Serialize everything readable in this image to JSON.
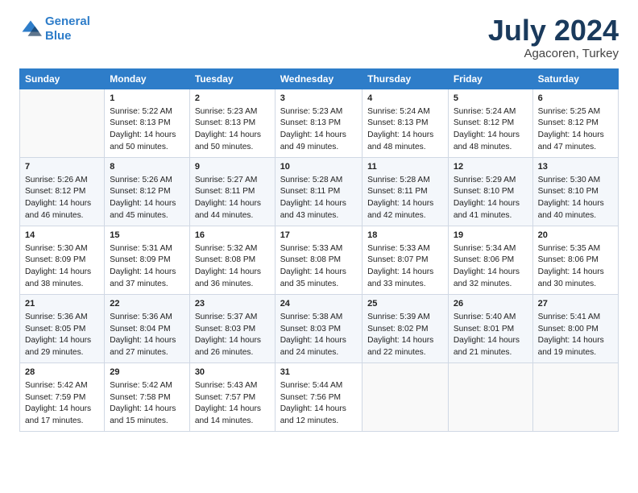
{
  "logo": {
    "line1": "General",
    "line2": "Blue"
  },
  "title": "July 2024",
  "subtitle": "Agacoren, Turkey",
  "header_days": [
    "Sunday",
    "Monday",
    "Tuesday",
    "Wednesday",
    "Thursday",
    "Friday",
    "Saturday"
  ],
  "weeks": [
    [
      {
        "day": "",
        "content": ""
      },
      {
        "day": "1",
        "content": "Sunrise: 5:22 AM\nSunset: 8:13 PM\nDaylight: 14 hours\nand 50 minutes."
      },
      {
        "day": "2",
        "content": "Sunrise: 5:23 AM\nSunset: 8:13 PM\nDaylight: 14 hours\nand 50 minutes."
      },
      {
        "day": "3",
        "content": "Sunrise: 5:23 AM\nSunset: 8:13 PM\nDaylight: 14 hours\nand 49 minutes."
      },
      {
        "day": "4",
        "content": "Sunrise: 5:24 AM\nSunset: 8:13 PM\nDaylight: 14 hours\nand 48 minutes."
      },
      {
        "day": "5",
        "content": "Sunrise: 5:24 AM\nSunset: 8:12 PM\nDaylight: 14 hours\nand 48 minutes."
      },
      {
        "day": "6",
        "content": "Sunrise: 5:25 AM\nSunset: 8:12 PM\nDaylight: 14 hours\nand 47 minutes."
      }
    ],
    [
      {
        "day": "7",
        "content": "Sunrise: 5:26 AM\nSunset: 8:12 PM\nDaylight: 14 hours\nand 46 minutes."
      },
      {
        "day": "8",
        "content": "Sunrise: 5:26 AM\nSunset: 8:12 PM\nDaylight: 14 hours\nand 45 minutes."
      },
      {
        "day": "9",
        "content": "Sunrise: 5:27 AM\nSunset: 8:11 PM\nDaylight: 14 hours\nand 44 minutes."
      },
      {
        "day": "10",
        "content": "Sunrise: 5:28 AM\nSunset: 8:11 PM\nDaylight: 14 hours\nand 43 minutes."
      },
      {
        "day": "11",
        "content": "Sunrise: 5:28 AM\nSunset: 8:11 PM\nDaylight: 14 hours\nand 42 minutes."
      },
      {
        "day": "12",
        "content": "Sunrise: 5:29 AM\nSunset: 8:10 PM\nDaylight: 14 hours\nand 41 minutes."
      },
      {
        "day": "13",
        "content": "Sunrise: 5:30 AM\nSunset: 8:10 PM\nDaylight: 14 hours\nand 40 minutes."
      }
    ],
    [
      {
        "day": "14",
        "content": "Sunrise: 5:30 AM\nSunset: 8:09 PM\nDaylight: 14 hours\nand 38 minutes."
      },
      {
        "day": "15",
        "content": "Sunrise: 5:31 AM\nSunset: 8:09 PM\nDaylight: 14 hours\nand 37 minutes."
      },
      {
        "day": "16",
        "content": "Sunrise: 5:32 AM\nSunset: 8:08 PM\nDaylight: 14 hours\nand 36 minutes."
      },
      {
        "day": "17",
        "content": "Sunrise: 5:33 AM\nSunset: 8:08 PM\nDaylight: 14 hours\nand 35 minutes."
      },
      {
        "day": "18",
        "content": "Sunrise: 5:33 AM\nSunset: 8:07 PM\nDaylight: 14 hours\nand 33 minutes."
      },
      {
        "day": "19",
        "content": "Sunrise: 5:34 AM\nSunset: 8:06 PM\nDaylight: 14 hours\nand 32 minutes."
      },
      {
        "day": "20",
        "content": "Sunrise: 5:35 AM\nSunset: 8:06 PM\nDaylight: 14 hours\nand 30 minutes."
      }
    ],
    [
      {
        "day": "21",
        "content": "Sunrise: 5:36 AM\nSunset: 8:05 PM\nDaylight: 14 hours\nand 29 minutes."
      },
      {
        "day": "22",
        "content": "Sunrise: 5:36 AM\nSunset: 8:04 PM\nDaylight: 14 hours\nand 27 minutes."
      },
      {
        "day": "23",
        "content": "Sunrise: 5:37 AM\nSunset: 8:03 PM\nDaylight: 14 hours\nand 26 minutes."
      },
      {
        "day": "24",
        "content": "Sunrise: 5:38 AM\nSunset: 8:03 PM\nDaylight: 14 hours\nand 24 minutes."
      },
      {
        "day": "25",
        "content": "Sunrise: 5:39 AM\nSunset: 8:02 PM\nDaylight: 14 hours\nand 22 minutes."
      },
      {
        "day": "26",
        "content": "Sunrise: 5:40 AM\nSunset: 8:01 PM\nDaylight: 14 hours\nand 21 minutes."
      },
      {
        "day": "27",
        "content": "Sunrise: 5:41 AM\nSunset: 8:00 PM\nDaylight: 14 hours\nand 19 minutes."
      }
    ],
    [
      {
        "day": "28",
        "content": "Sunrise: 5:42 AM\nSunset: 7:59 PM\nDaylight: 14 hours\nand 17 minutes."
      },
      {
        "day": "29",
        "content": "Sunrise: 5:42 AM\nSunset: 7:58 PM\nDaylight: 14 hours\nand 15 minutes."
      },
      {
        "day": "30",
        "content": "Sunrise: 5:43 AM\nSunset: 7:57 PM\nDaylight: 14 hours\nand 14 minutes."
      },
      {
        "day": "31",
        "content": "Sunrise: 5:44 AM\nSunset: 7:56 PM\nDaylight: 14 hours\nand 12 minutes."
      },
      {
        "day": "",
        "content": ""
      },
      {
        "day": "",
        "content": ""
      },
      {
        "day": "",
        "content": ""
      }
    ]
  ]
}
